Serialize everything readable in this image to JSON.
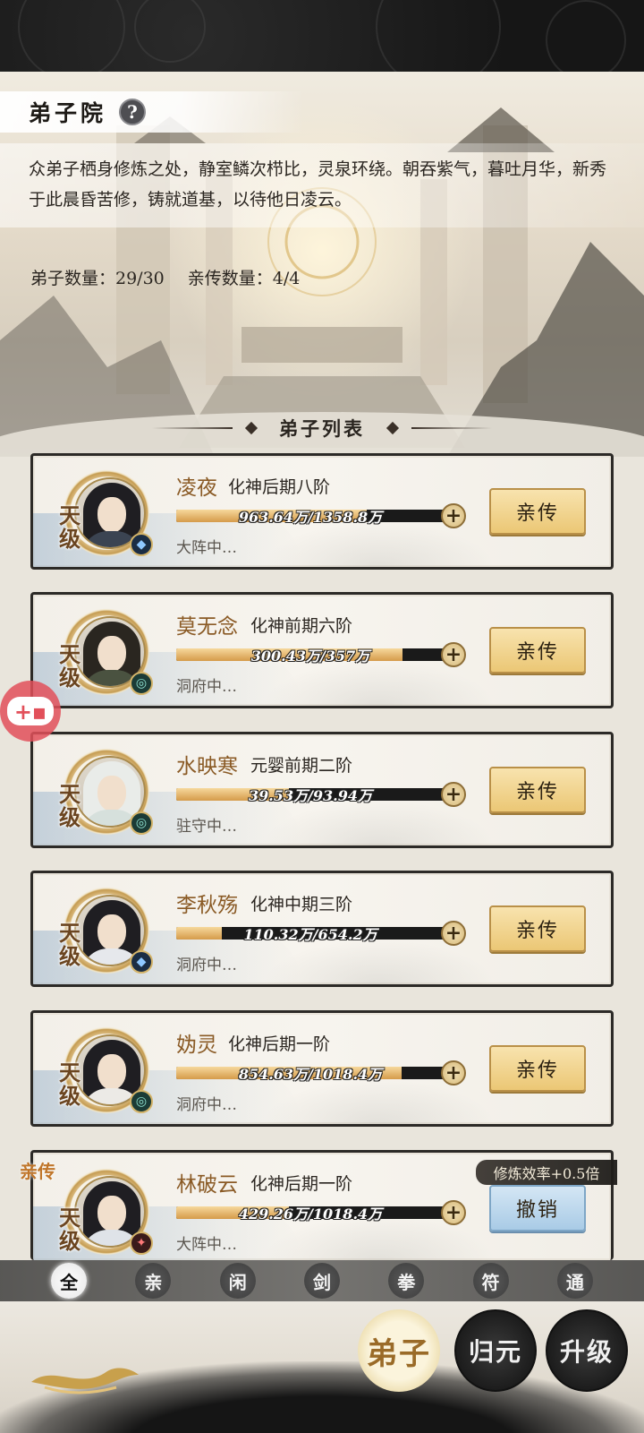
{
  "header": {
    "title": "弟子院",
    "help_label": "?",
    "description": "众弟子栖身修炼之处，静室鳞次栉比，灵泉环绕。朝吞紫气，暮吐月华，新秀于此晨昏苦修，铸就道基，以待他日凌云。",
    "disciple_count": "弟子数量：29/30",
    "inner_count": "亲传数量：4/4"
  },
  "list_title": "弟子列表",
  "disciples": [
    {
      "rank": "天级",
      "name": "凌夜",
      "realm": "化神后期八阶",
      "progress_text": "963.64万/1358.8万",
      "progress": 0.709,
      "status": "大阵中…",
      "element": "blue",
      "action": "亲传"
    },
    {
      "rank": "天级",
      "name": "莫无念",
      "realm": "化神前期六阶",
      "progress_text": "300.43万/357万",
      "progress": 0.842,
      "status": "洞府中…",
      "element": "green",
      "action": "亲传"
    },
    {
      "rank": "天级",
      "name": "水映寒",
      "realm": "元婴前期二阶",
      "progress_text": "39.53万/93.94万",
      "progress": 0.421,
      "status": "驻守中…",
      "element": "green",
      "action": "亲传"
    },
    {
      "rank": "天级",
      "name": "李秋殇",
      "realm": "化神中期三阶",
      "progress_text": "110.32万/654.2万",
      "progress": 0.169,
      "status": "洞府中…",
      "element": "blue",
      "action": "亲传"
    },
    {
      "rank": "天级",
      "name": "妫灵",
      "realm": "化神后期一阶",
      "progress_text": "854.63万/1018.4万",
      "progress": 0.839,
      "status": "洞府中…",
      "element": "green",
      "action": "亲传"
    },
    {
      "rank": "天级",
      "name": "林破云",
      "realm": "化神后期一阶",
      "progress_text": "429.26万/1018.4万",
      "progress": 0.421,
      "status": "大阵中…",
      "element": "red",
      "action": "撤销"
    }
  ],
  "inner_tag": "亲传",
  "boost_tag": "修炼效率+0.5倍",
  "filters": [
    "全",
    "亲",
    "闲",
    "剑",
    "拳",
    "符",
    "通"
  ],
  "active_filter": "全",
  "nav": [
    {
      "label": "弟子",
      "active": true
    },
    {
      "label": "归元",
      "active": false
    },
    {
      "label": "升级",
      "active": false
    }
  ],
  "colors": {
    "accent_gold": "#ebc775",
    "revoke_blue": "#a9cbe6",
    "name_brown": "#8a5a25"
  },
  "icons": {
    "help": "question-icon",
    "plus": "plus-icon",
    "floating": "gamepad-icon"
  }
}
